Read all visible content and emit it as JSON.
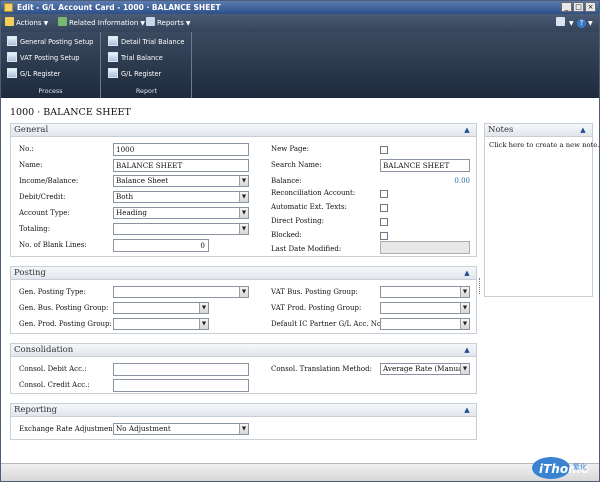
{
  "window": {
    "title": "Edit - G/L Account Card - 1000 · BALANCE SHEET",
    "buttons": [
      "_",
      "□",
      "×"
    ]
  },
  "menu": {
    "actions": "Actions",
    "related": "Related Information",
    "reports": "Reports",
    "help": "?"
  },
  "ribbon": {
    "process": {
      "label": "Process",
      "items": [
        "General Posting Setup",
        "VAT Posting Setup",
        "G/L Register"
      ]
    },
    "report": {
      "label": "Report",
      "items": [
        "Detail Trial Balance",
        "Trial Balance",
        "G/L Register"
      ]
    }
  },
  "page_title": "1000 ·  BALANCE SHEET",
  "general": {
    "header": "General",
    "no_label": "No.:",
    "no_value": "1000",
    "name_label": "Name:",
    "name_value": "BALANCE SHEET",
    "income_label": "Income/Balance:",
    "income_value": "Balance Sheet",
    "debit_label": "Debit/Credit:",
    "debit_value": "Both",
    "acct_type_label": "Account Type:",
    "acct_type_value": "Heading",
    "totaling_label": "Totaling:",
    "totaling_value": "",
    "blank_lines_label": "No. of Blank Lines:",
    "blank_lines_value": "0",
    "new_page_label": "New Page:",
    "search_name_label": "Search Name:",
    "search_name_value": "BALANCE SHEET",
    "balance_label": "Balance:",
    "balance_value": "0.00",
    "reconciliation_label": "Reconciliation Account:",
    "auto_ext_label": "Automatic Ext. Texts:",
    "direct_posting_label": "Direct Posting:",
    "blocked_label": "Blocked:",
    "last_modified_label": "Last Date Modified:",
    "last_modified_value": ""
  },
  "posting": {
    "header": "Posting",
    "gen_posting_type_label": "Gen. Posting Type:",
    "gen_bus_label": "Gen. Bus. Posting Group:",
    "gen_prod_label": "Gen. Prod. Posting Group:",
    "vat_bus_label": "VAT Bus. Posting Group:",
    "vat_prod_label": "VAT Prod. Posting Group:",
    "ic_partner_label": "Default IC Partner G/L Acc. No:"
  },
  "consolidation": {
    "header": "Consolidation",
    "debit_acc_label": "Consol. Debit Acc.:",
    "credit_acc_label": "Consol. Credit Acc.:",
    "translation_label": "Consol. Translation Method:",
    "translation_value": "Average Rate (Manual)"
  },
  "reporting": {
    "header": "Reporting",
    "exchange_label": "Exchange Rate Adjustment:",
    "exchange_value": "No Adjustment"
  },
  "notes": {
    "header": "Notes",
    "link": "Click here to create a new note."
  },
  "logo": {
    "text": "iThome",
    "cn": "繁化"
  }
}
